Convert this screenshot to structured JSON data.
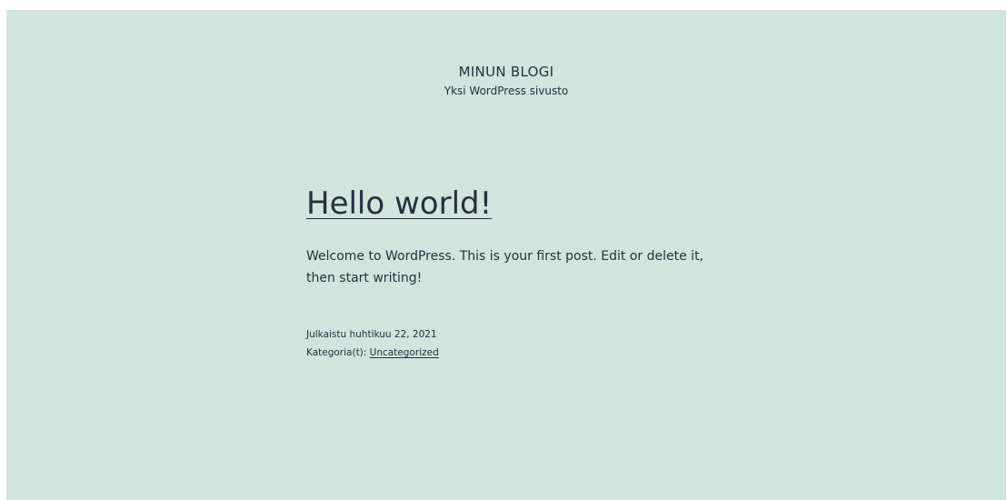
{
  "header": {
    "site_title": "MINUN BLOGI",
    "site_description": "Yksi WordPress sivusto"
  },
  "post": {
    "title": "Hello world!",
    "content": "Welcome to WordPress. This is your first post. Edit or delete it, then start writing!",
    "published_label": "Julkaistu huhtikuu 22, 2021",
    "categories_label": "Kategoria(t):",
    "category_link": "Uncategorized"
  },
  "colors": {
    "background": "#d1e4dd",
    "text": "#28303d"
  }
}
